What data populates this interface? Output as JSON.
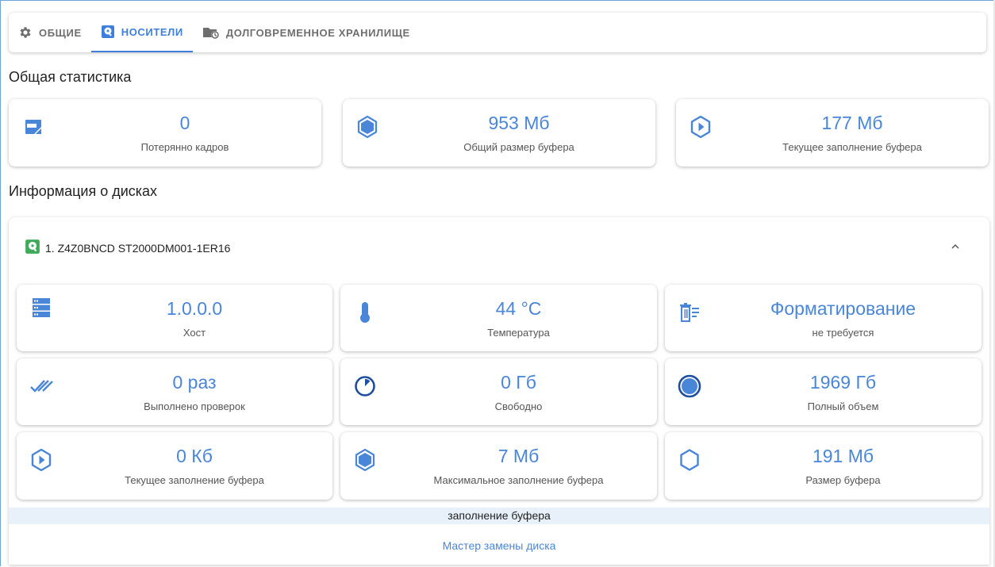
{
  "tabs": [
    {
      "label": "ОБЩИЕ",
      "icon": "gear-icon",
      "active": false
    },
    {
      "label": "НОСИТЕЛИ",
      "icon": "drive-icon",
      "active": true
    },
    {
      "label": "ДОЛГОВРЕМЕННОЕ ХРАНИЛИЩЕ",
      "icon": "archive-folder-icon",
      "active": false
    }
  ],
  "general_stats": {
    "title": "Общая статистика",
    "cards": [
      {
        "value": "0",
        "label": "Потерянно кадров",
        "icon": "lost-frames-icon"
      },
      {
        "value": "953 Мб",
        "label": "Общий размер буфера",
        "icon": "hexagon-filled-icon"
      },
      {
        "value": "177 Мб",
        "label": "Текущее заполнение буфера",
        "icon": "hexagon-play-icon"
      }
    ]
  },
  "disk_info": {
    "title": "Информация о дисках",
    "disk_name": "1. Z4Z0BNCD ST2000DM001-1ER16",
    "cards": [
      {
        "value": "1.0.0.0",
        "label": "Хост",
        "icon": "server-icon"
      },
      {
        "value": "44 °C",
        "label": "Температура",
        "icon": "thermometer-icon"
      },
      {
        "value": "Форматирование",
        "label": "не требуется",
        "icon": "format-trash-icon"
      },
      {
        "value": "0 раз",
        "label": "Выполнено проверок",
        "icon": "double-check-icon"
      },
      {
        "value": "0 Гб",
        "label": "Свободно",
        "icon": "pie-free-icon"
      },
      {
        "value": "1969 Гб",
        "label": "Полный объем",
        "icon": "full-circle-icon"
      },
      {
        "value": "0 Кб",
        "label": "Текущее заполнение буфера",
        "icon": "hexagon-play-icon"
      },
      {
        "value": "7 Мб",
        "label": "Максимальное заполнение буфера",
        "icon": "hexagon-filled-icon"
      },
      {
        "value": "191 Мб",
        "label": "Размер буфера",
        "icon": "hexagon-outline-icon"
      }
    ],
    "fill_bar_label": "заполнение буфера",
    "replace_wizard_label": "Мастер замены диска"
  },
  "colors": {
    "accent": "#4a86d8",
    "active_tab": "#3f7fd9",
    "drive_green": "#3faa5a"
  }
}
